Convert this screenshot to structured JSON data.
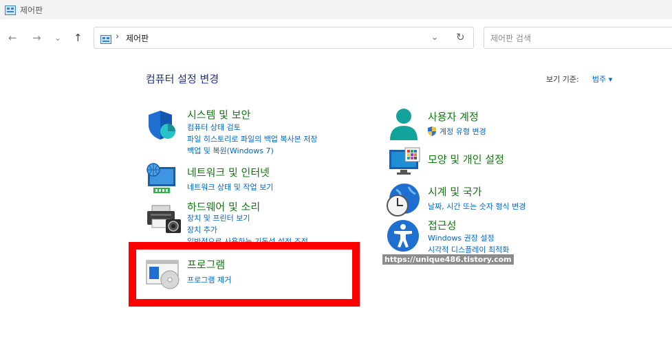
{
  "window": {
    "title": "제어판"
  },
  "addressbar": {
    "breadcrumb_sep": "›",
    "breadcrumb": "제어판",
    "dropdown": "⌄",
    "refresh": "↻"
  },
  "search": {
    "placeholder": "제어판 검색"
  },
  "nav": {
    "back": "←",
    "forward": "→",
    "recent": "⌄",
    "up": "↑"
  },
  "main": {
    "title": "컴퓨터 설정 변경",
    "view_by_label": "보기 기준:",
    "view_by_value": "범주 ▾"
  },
  "categories_left": [
    {
      "title": "시스템 및 보안",
      "links": [
        "컴퓨터 상태 검토",
        "파일 히스토리로 파일의 백업 복사본 저장",
        "백업 및 복원(Windows 7)"
      ]
    },
    {
      "title": "네트워크 및 인터넷",
      "links": [
        "네트워크 상태 및 작업 보기"
      ]
    },
    {
      "title": "하드웨어 및 소리",
      "links": [
        "장치 및 프린터 보기",
        "장치 추가",
        "일반적으로 사용하는 기동성 설정 조정"
      ]
    },
    {
      "title": "프로그램",
      "links": [
        "프로그램 제거"
      ]
    }
  ],
  "categories_right": [
    {
      "title": "사용자 계정",
      "links": [
        "계정 유형 변경"
      ]
    },
    {
      "title": "모양 및 개인 설정",
      "links": []
    },
    {
      "title": "시계 및 국가",
      "links": [
        "날짜, 시간 또는 숫자 형식 변경"
      ]
    },
    {
      "title": "접근성",
      "links": [
        "Windows 권장 설정",
        "시각적 디스플레이 최적화"
      ]
    }
  ],
  "watermark": "https://unique486.tistory.com",
  "colors": {
    "category_title": "#0e7a0d",
    "link": "#0066cc",
    "page_title": "#1e3287",
    "highlight": "#ff0000"
  },
  "icons": [
    "control-panel-icon",
    "shield-icon",
    "network-icon",
    "printer-icon",
    "programs-icon",
    "user-icon",
    "display-icon",
    "clock-globe-icon",
    "accessibility-icon",
    "uac-shield-icon"
  ]
}
